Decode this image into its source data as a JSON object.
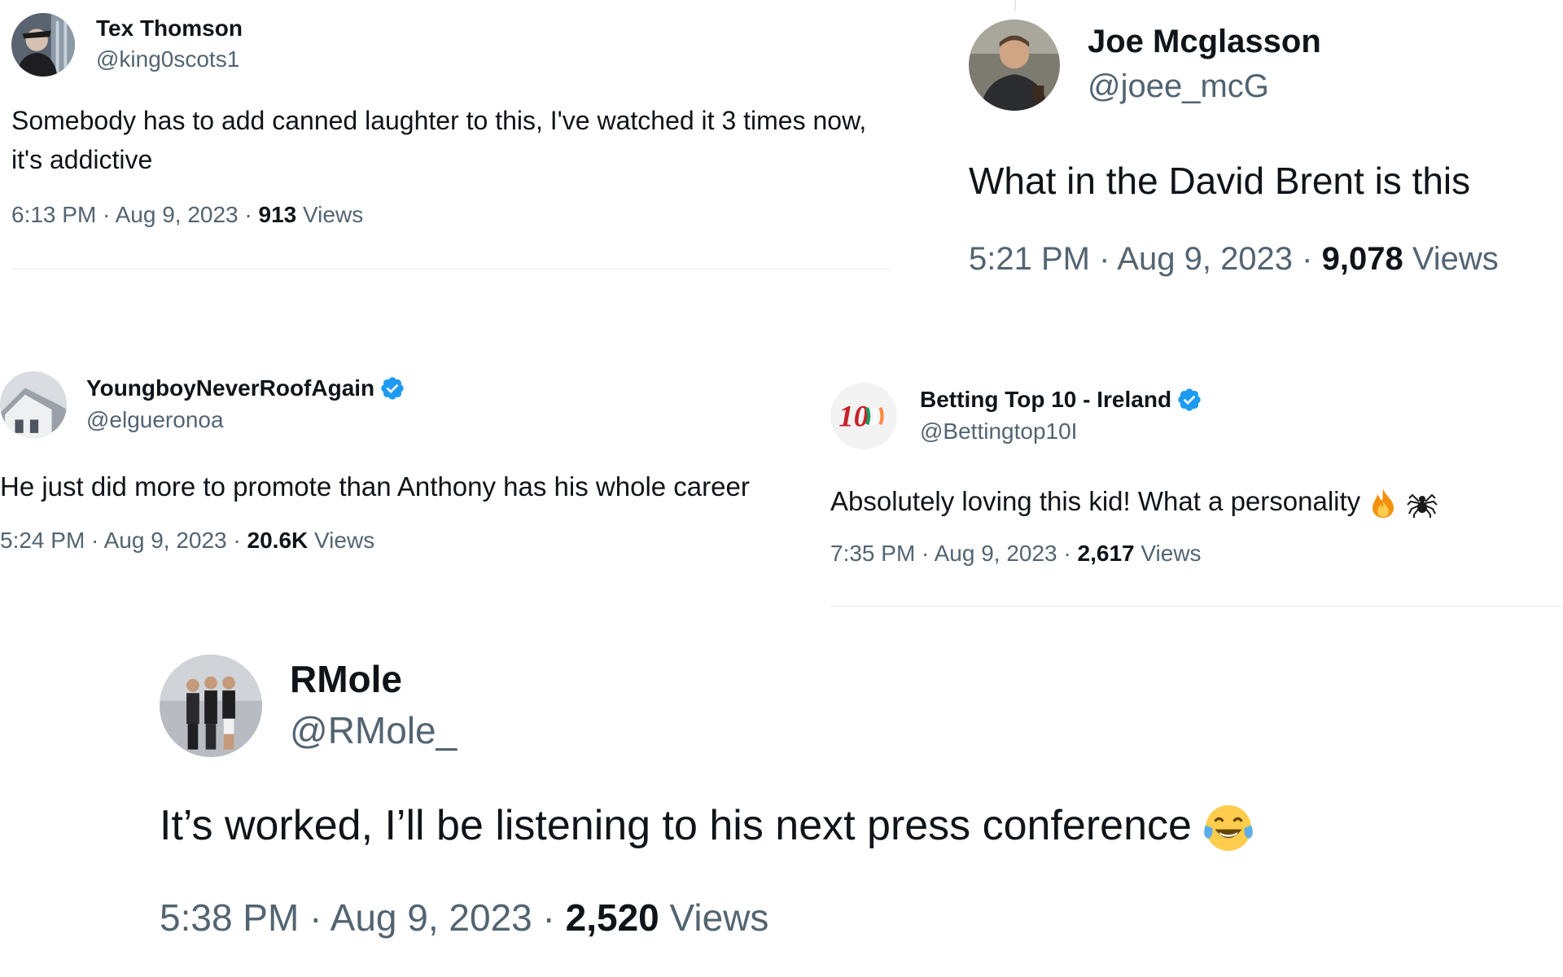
{
  "tweets": [
    {
      "name": "Tex Thomson",
      "handle": "@king0scots1",
      "verified": false,
      "text": "Somebody has to add canned laughter to this, I've watched it 3 times now, it's addictive",
      "time": "6:13 PM · Aug 9, 2023 · ",
      "views_count": "913",
      "views_label": " Views"
    },
    {
      "name": "Joe Mcglasson",
      "handle": "@joee_mcG",
      "verified": false,
      "text": "What in the David Brent is this",
      "time": "5:21 PM · Aug 9, 2023 · ",
      "views_count": "9,078",
      "views_label": " Views"
    },
    {
      "name": "YoungboyNeverRoofAgain",
      "handle": "@elgueronoa",
      "verified": true,
      "text": "He just did more to promote than Anthony has his whole career",
      "time": "5:24 PM · Aug 9, 2023 · ",
      "views_count": "20.6K",
      "views_label": " Views"
    },
    {
      "name": "Betting Top 10 - Ireland",
      "handle": "@Bettingtop10I",
      "verified": true,
      "text": "Absolutely loving this kid! What a personality",
      "emojis": [
        "fire-emoji",
        "spider-emoji"
      ],
      "time": "7:35 PM · Aug 9, 2023 · ",
      "views_count": "2,617",
      "views_label": " Views"
    },
    {
      "name": "RMole",
      "handle": "@RMole_",
      "verified": false,
      "text": "It’s worked, I’ll be listening to his next press conference",
      "emojis": [
        "tears-of-joy-emoji"
      ],
      "time": "5:38 PM · Aug 9, 2023 · ",
      "views_count": "2,520",
      "views_label": " Views"
    }
  ],
  "colors": {
    "text": "#0f1419",
    "secondary": "#536471",
    "verified": "#1d9bf0",
    "divider": "#e7e9ea"
  }
}
